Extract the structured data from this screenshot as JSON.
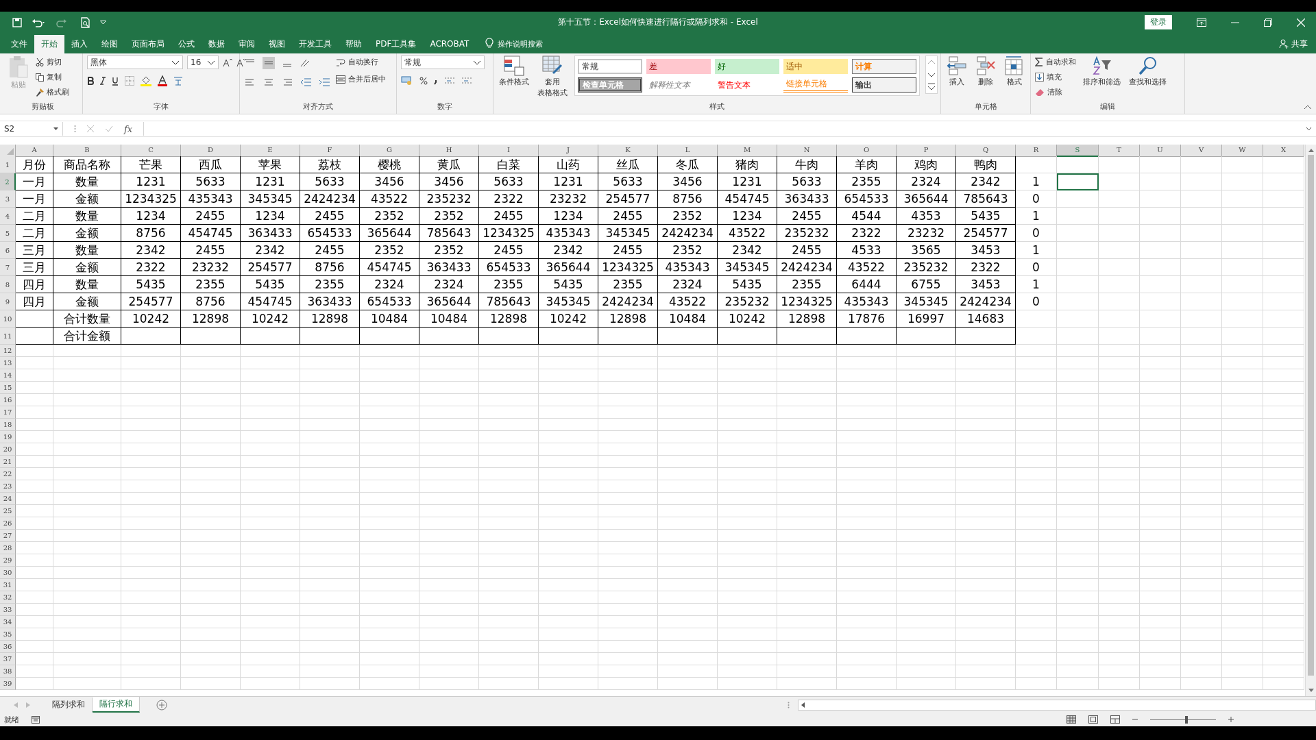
{
  "window": {
    "title": "第十五节：Excel如何快速进行隔行或隔列求和  -  Excel",
    "login": "登录",
    "share": "共享"
  },
  "menu_tabs": [
    {
      "label": "文件",
      "selected": false
    },
    {
      "label": "开始",
      "selected": true
    },
    {
      "label": "插入",
      "selected": false
    },
    {
      "label": "绘图",
      "selected": false
    },
    {
      "label": "页面布局",
      "selected": false
    },
    {
      "label": "公式",
      "selected": false
    },
    {
      "label": "数据",
      "selected": false
    },
    {
      "label": "审阅",
      "selected": false
    },
    {
      "label": "视图",
      "selected": false
    },
    {
      "label": "开发工具",
      "selected": false
    },
    {
      "label": "帮助",
      "selected": false
    },
    {
      "label": "PDF工具集",
      "selected": false
    },
    {
      "label": "ACROBAT",
      "selected": false
    }
  ],
  "tell_me": "操作说明搜索",
  "ribbon": {
    "clipboard": {
      "paste": "粘贴",
      "cut": "剪切",
      "copy": "复制",
      "format_painter": "格式刷",
      "label": "剪贴板"
    },
    "font": {
      "name": "黑体",
      "size": "16",
      "label": "字体"
    },
    "alignment": {
      "wrap": "自动换行",
      "merge": "合并后居中",
      "label": "对齐方式"
    },
    "number": {
      "format": "常规",
      "label": "数字"
    },
    "styles": {
      "conditional": "条件格式",
      "table_format": [
        "套用",
        "表格格式"
      ],
      "label": "样式",
      "cell_styles": [
        {
          "label": "常规",
          "kind": "normal"
        },
        {
          "label": "差",
          "kind": "bad"
        },
        {
          "label": "好",
          "kind": "good"
        },
        {
          "label": "适中",
          "kind": "neutral"
        },
        {
          "label": "计算",
          "kind": "calculation"
        },
        {
          "label": "检查单元格",
          "kind": "check"
        },
        {
          "label": "解释性文本",
          "kind": "explanatory"
        },
        {
          "label": "警告文本",
          "kind": "warning"
        },
        {
          "label": "链接单元格",
          "kind": "linked"
        },
        {
          "label": "输出",
          "kind": "output"
        }
      ]
    },
    "cells": {
      "insert": "插入",
      "delete": "删除",
      "format": "格式",
      "label": "单元格"
    },
    "editing": {
      "autosum": "自动求和",
      "fill": "填充",
      "clear": "清除",
      "sort": "排序和筛选",
      "find": "查找和选择",
      "label": "编辑"
    }
  },
  "formula_bar": {
    "name_box": "S2",
    "function_button": "fx"
  },
  "sheet": {
    "columns": [
      {
        "label": "A",
        "selected": false,
        "bordered": true
      },
      {
        "label": "B",
        "selected": false,
        "bordered": true
      },
      {
        "label": "C",
        "selected": false,
        "bordered": true
      },
      {
        "label": "D",
        "selected": false,
        "bordered": true
      },
      {
        "label": "E",
        "selected": false,
        "bordered": true
      },
      {
        "label": "F",
        "selected": false,
        "bordered": true
      },
      {
        "label": "G",
        "selected": false,
        "bordered": true
      },
      {
        "label": "H",
        "selected": false,
        "bordered": true
      },
      {
        "label": "I",
        "selected": false,
        "bordered": true
      },
      {
        "label": "J",
        "selected": false,
        "bordered": true
      },
      {
        "label": "K",
        "selected": false,
        "bordered": true
      },
      {
        "label": "L",
        "selected": false,
        "bordered": true
      },
      {
        "label": "M",
        "selected": false,
        "bordered": true
      },
      {
        "label": "N",
        "selected": false,
        "bordered": true
      },
      {
        "label": "O",
        "selected": false,
        "bordered": true
      },
      {
        "label": "P",
        "selected": false,
        "bordered": true
      },
      {
        "label": "Q",
        "selected": false,
        "bordered": true
      },
      {
        "label": "R",
        "selected": false,
        "bordered": false
      },
      {
        "label": "S",
        "selected": true,
        "bordered": false
      },
      {
        "label": "T",
        "selected": false,
        "bordered": false
      },
      {
        "label": "U",
        "selected": false,
        "bordered": false
      },
      {
        "label": "V",
        "selected": false,
        "bordered": false
      },
      {
        "label": "W",
        "selected": false,
        "bordered": false
      },
      {
        "label": "X",
        "selected": false,
        "bordered": false
      }
    ],
    "rows": [
      {
        "number": "1",
        "selected": false,
        "bordered": true,
        "cells": {
          "A": "月份",
          "B": "商品名称",
          "C": "芒果",
          "D": "西瓜",
          "E": "苹果",
          "F": "荔枝",
          "G": "樱桃",
          "H": "黄瓜",
          "I": "白菜",
          "J": "山药",
          "K": "丝瓜",
          "L": "冬瓜",
          "M": "猪肉",
          "N": "牛肉",
          "O": "羊肉",
          "P": "鸡肉",
          "Q": "鸭肉"
        }
      },
      {
        "number": "2",
        "selected": true,
        "bordered": true,
        "cells": {
          "A": "一月",
          "B": "数量",
          "C": "1231",
          "D": "5633",
          "E": "1231",
          "F": "5633",
          "G": "3456",
          "H": "3456",
          "I": "5633",
          "J": "1231",
          "K": "5633",
          "L": "3456",
          "M": "1231",
          "N": "5633",
          "O": "2355",
          "P": "2324",
          "Q": "2342",
          "R": "1"
        }
      },
      {
        "number": "3",
        "selected": false,
        "bordered": true,
        "cells": {
          "A": "一月",
          "B": "金额",
          "C": "1234325",
          "D": "435343",
          "E": "345345",
          "F": "2424234",
          "G": "43522",
          "H": "235232",
          "I": "2322",
          "J": "23232",
          "K": "254577",
          "L": "8756",
          "M": "454745",
          "N": "363433",
          "O": "654533",
          "P": "365644",
          "Q": "785643",
          "R": "0"
        }
      },
      {
        "number": "4",
        "selected": false,
        "bordered": true,
        "cells": {
          "A": "二月",
          "B": "数量",
          "C": "1234",
          "D": "2455",
          "E": "1234",
          "F": "2455",
          "G": "2352",
          "H": "2352",
          "I": "2455",
          "J": "1234",
          "K": "2455",
          "L": "2352",
          "M": "1234",
          "N": "2455",
          "O": "4544",
          "P": "4353",
          "Q": "5435",
          "R": "1"
        }
      },
      {
        "number": "5",
        "selected": false,
        "bordered": true,
        "cells": {
          "A": "二月",
          "B": "金额",
          "C": "8756",
          "D": "454745",
          "E": "363433",
          "F": "654533",
          "G": "365644",
          "H": "785643",
          "I": "1234325",
          "J": "435343",
          "K": "345345",
          "L": "2424234",
          "M": "43522",
          "N": "235232",
          "O": "2322",
          "P": "23232",
          "Q": "254577",
          "R": "0"
        }
      },
      {
        "number": "6",
        "selected": false,
        "bordered": true,
        "cells": {
          "A": "三月",
          "B": "数量",
          "C": "2342",
          "D": "2455",
          "E": "2342",
          "F": "2455",
          "G": "2352",
          "H": "2352",
          "I": "2455",
          "J": "2342",
          "K": "2455",
          "L": "2352",
          "M": "2342",
          "N": "2455",
          "O": "4533",
          "P": "3565",
          "Q": "3453",
          "R": "1"
        }
      },
      {
        "number": "7",
        "selected": false,
        "bordered": true,
        "cells": {
          "A": "三月",
          "B": "金额",
          "C": "2322",
          "D": "23232",
          "E": "254577",
          "F": "8756",
          "G": "454745",
          "H": "363433",
          "I": "654533",
          "J": "365644",
          "K": "1234325",
          "L": "435343",
          "M": "345345",
          "N": "2424234",
          "O": "43522",
          "P": "235232",
          "Q": "2322",
          "R": "0"
        }
      },
      {
        "number": "8",
        "selected": false,
        "bordered": true,
        "cells": {
          "A": "四月",
          "B": "数量",
          "C": "5435",
          "D": "2355",
          "E": "5435",
          "F": "2355",
          "G": "2324",
          "H": "2324",
          "I": "2355",
          "J": "5435",
          "K": "2355",
          "L": "2324",
          "M": "5435",
          "N": "2355",
          "O": "6444",
          "P": "6755",
          "Q": "3453",
          "R": "1"
        }
      },
      {
        "number": "9",
        "selected": false,
        "bordered": true,
        "cells": {
          "A": "四月",
          "B": "金额",
          "C": "254577",
          "D": "8756",
          "E": "454745",
          "F": "363433",
          "G": "654533",
          "H": "365644",
          "I": "785643",
          "J": "345345",
          "K": "2424234",
          "L": "43522",
          "M": "235232",
          "N": "1234325",
          "O": "435343",
          "P": "345345",
          "Q": "2424234",
          "R": "0"
        }
      },
      {
        "number": "10",
        "selected": false,
        "bordered": true,
        "cells": {
          "B": "合计数量",
          "C": "10242",
          "D": "12898",
          "E": "10242",
          "F": "12898",
          "G": "10484",
          "H": "10484",
          "I": "12898",
          "J": "10242",
          "K": "12898",
          "L": "10484",
          "M": "10242",
          "N": "12898",
          "O": "17876",
          "P": "16997",
          "Q": "14683"
        }
      },
      {
        "number": "11",
        "selected": false,
        "bordered": true,
        "cells": {
          "B": "合计金额"
        }
      },
      {
        "number": "12",
        "selected": false,
        "bordered": false
      },
      {
        "number": "13",
        "selected": false,
        "bordered": false
      },
      {
        "number": "14",
        "selected": false,
        "bordered": false
      },
      {
        "number": "15",
        "selected": false,
        "bordered": false
      },
      {
        "number": "16",
        "selected": false,
        "bordered": false
      },
      {
        "number": "17",
        "selected": false,
        "bordered": false
      },
      {
        "number": "18",
        "selected": false,
        "bordered": false
      },
      {
        "number": "19",
        "selected": false,
        "bordered": false
      },
      {
        "number": "20",
        "selected": false,
        "bordered": false
      },
      {
        "number": "21",
        "selected": false,
        "bordered": false
      },
      {
        "number": "22",
        "selected": false,
        "bordered": false
      },
      {
        "number": "23",
        "selected": false,
        "bordered": false
      },
      {
        "number": "24",
        "selected": false,
        "bordered": false
      },
      {
        "number": "25",
        "selected": false,
        "bordered": false
      },
      {
        "number": "26",
        "selected": false,
        "bordered": false
      },
      {
        "number": "27",
        "selected": false,
        "bordered": false
      },
      {
        "number": "28",
        "selected": false,
        "bordered": false
      },
      {
        "number": "29",
        "selected": false,
        "bordered": false
      },
      {
        "number": "30",
        "selected": false,
        "bordered": false
      },
      {
        "number": "31",
        "selected": false,
        "bordered": false
      },
      {
        "number": "32",
        "selected": false,
        "bordered": false
      },
      {
        "number": "33",
        "selected": false,
        "bordered": false
      },
      {
        "number": "34",
        "selected": false,
        "bordered": false
      },
      {
        "number": "35",
        "selected": false,
        "bordered": false
      },
      {
        "number": "36",
        "selected": false,
        "bordered": false
      },
      {
        "number": "37",
        "selected": false,
        "bordered": false
      },
      {
        "number": "38",
        "selected": false,
        "bordered": false
      },
      {
        "number": "39",
        "selected": false,
        "bordered": false
      }
    ]
  },
  "sheet_tabs": [
    {
      "label": "隔列求和",
      "selected": false
    },
    {
      "label": "隔行求和",
      "selected": true
    }
  ],
  "status_bar": {
    "text": "就绪",
    "zoom": {
      "level": 0.55
    }
  }
}
